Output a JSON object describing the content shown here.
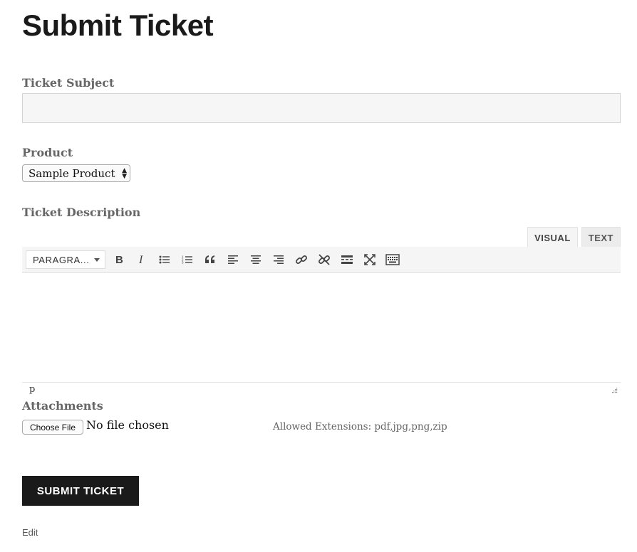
{
  "page": {
    "title": "Submit Ticket"
  },
  "form": {
    "subject": {
      "label": "Ticket Subject",
      "value": "",
      "placeholder": ""
    },
    "product": {
      "label": "Product",
      "selected": "Sample Product"
    },
    "description": {
      "label": "Ticket Description",
      "tabs": [
        {
          "label": "VISUAL",
          "active": true
        },
        {
          "label": "TEXT",
          "active": false
        }
      ],
      "format_select": "PARAGRA...",
      "toolbar_icons": [
        "bold-icon",
        "italic-icon",
        "bullet-list-icon",
        "numbered-list-icon",
        "blockquote-icon",
        "align-left-icon",
        "align-center-icon",
        "align-right-icon",
        "link-icon",
        "unlink-icon",
        "read-more-icon",
        "fullscreen-icon",
        "keyboard-icon"
      ],
      "body_text": "",
      "status_path": "p"
    },
    "attachments": {
      "label": "Attachments",
      "button_label": "Choose File",
      "file_status": "No file chosen",
      "allowed_extensions": "Allowed Extensions: pdf,jpg,png,zip"
    },
    "submit_label": "SUBMIT TICKET"
  },
  "footer": {
    "edit_label": "Edit"
  }
}
